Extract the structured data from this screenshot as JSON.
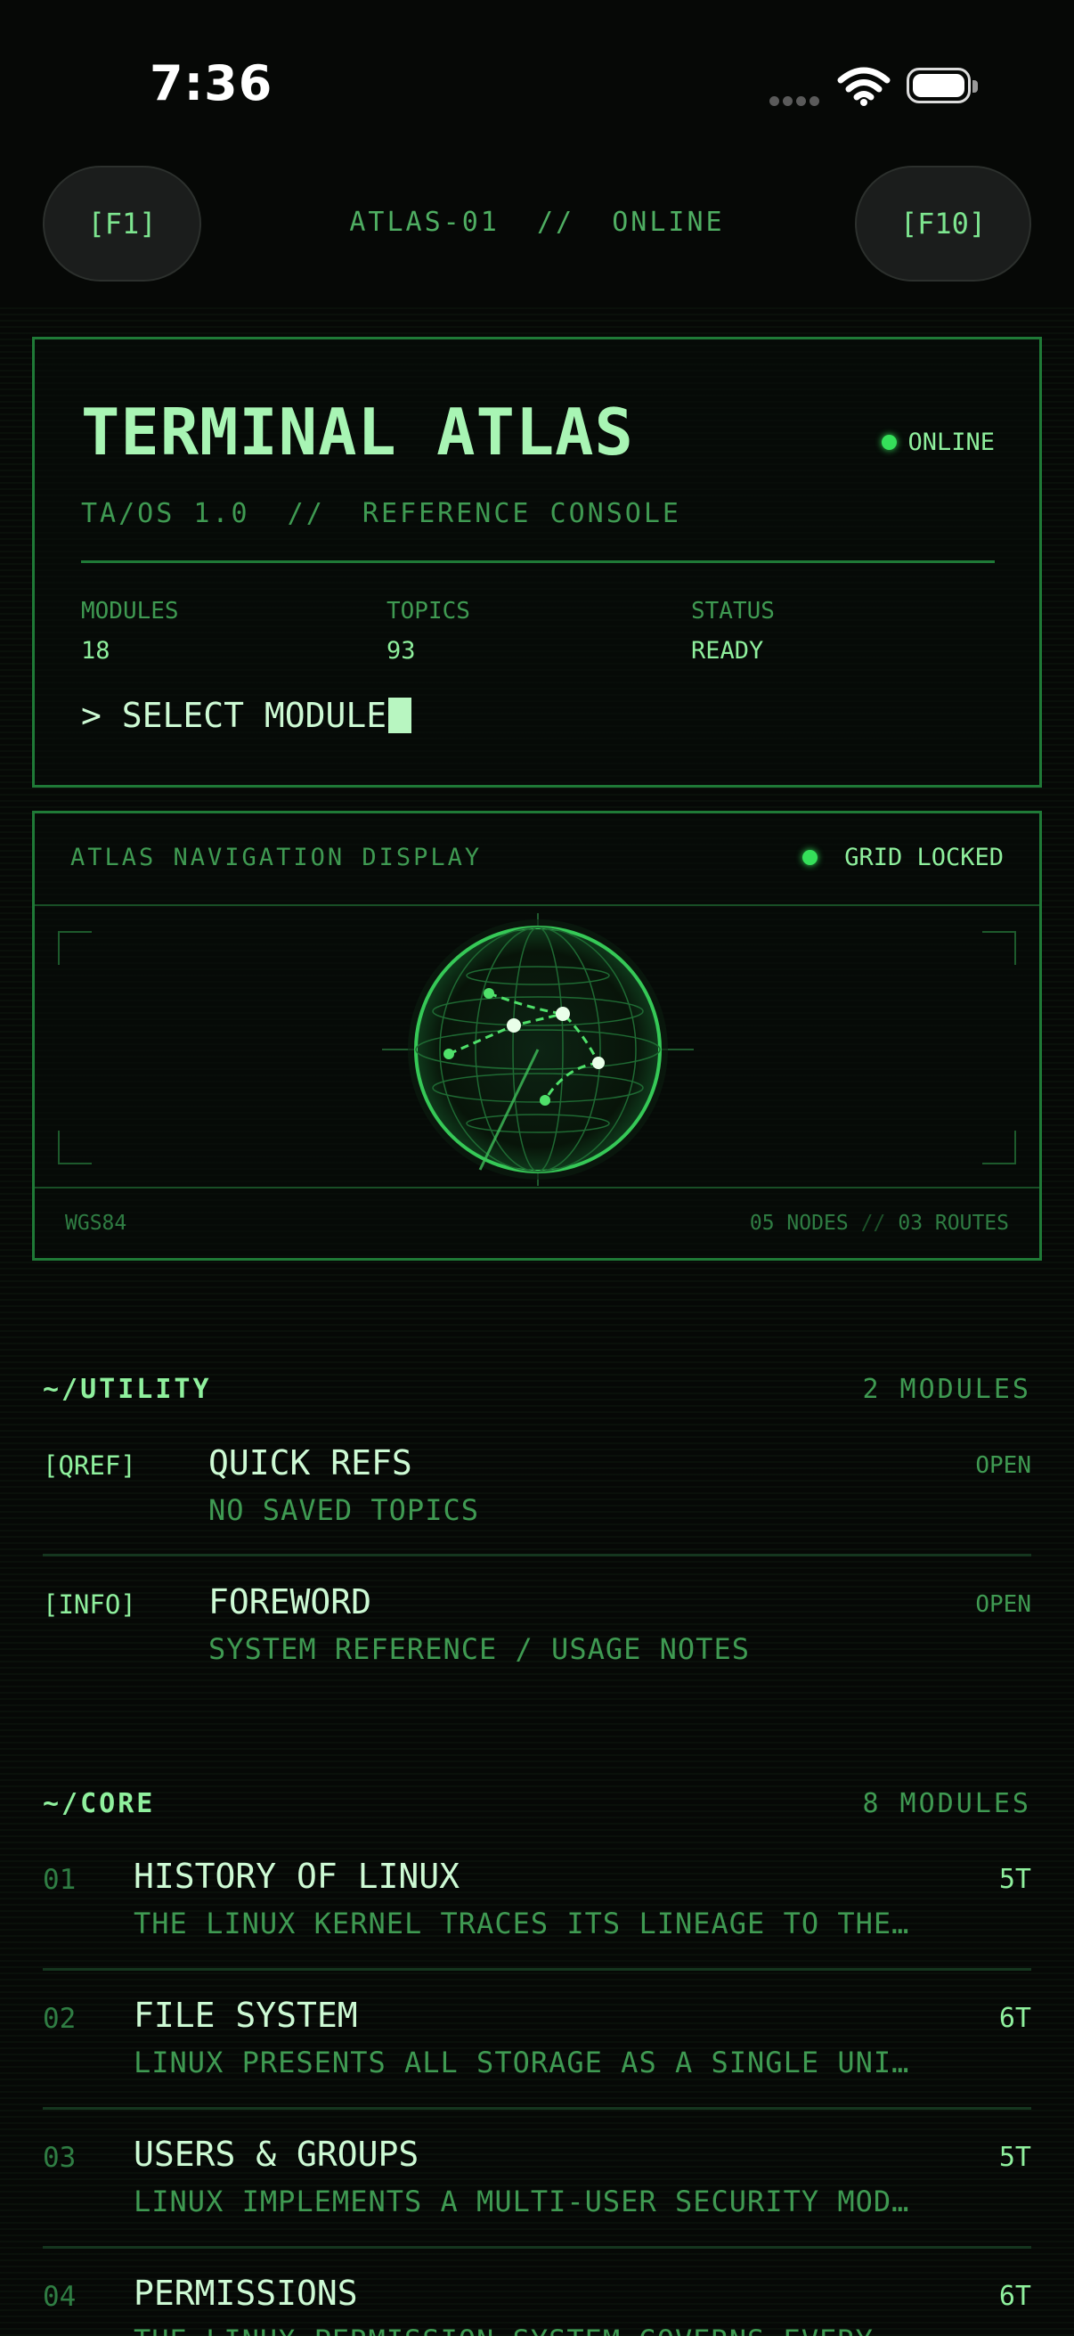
{
  "status_bar": {
    "time": "7:36"
  },
  "nav": {
    "left_key": "[F1]",
    "title": "ATLAS-01  //  ONLINE",
    "right_key": "[F10]"
  },
  "hero": {
    "title": "TERMINAL ATLAS",
    "status": "ONLINE",
    "subtitle": "TA/OS 1.0  //  REFERENCE CONSOLE",
    "stats": [
      {
        "label": "MODULES",
        "value": "18"
      },
      {
        "label": "TOPICS",
        "value": "93"
      },
      {
        "label": "STATUS",
        "value": "READY"
      }
    ],
    "prompt": "> SELECT MODULE"
  },
  "nav_display": {
    "title": "ATLAS NAVIGATION DISPLAY",
    "status": "GRID LOCKED",
    "datum": "WGS84",
    "nodes": "05 NODES",
    "separator": "//",
    "routes": "03 ROUTES"
  },
  "utility": {
    "name": "~/UTILITY",
    "count": "2 MODULES",
    "items": [
      {
        "tag": "[QREF]",
        "title": "QUICK REFS",
        "desc": "NO SAVED TOPICS",
        "action": "OPEN"
      },
      {
        "tag": "[INFO]",
        "title": "FOREWORD",
        "desc": "SYSTEM REFERENCE / USAGE NOTES",
        "action": "OPEN"
      }
    ]
  },
  "core": {
    "name": "~/CORE",
    "count": "8 MODULES",
    "items": [
      {
        "num": "01",
        "title": "HISTORY OF LINUX",
        "desc": "THE LINUX KERNEL TRACES ITS LINEAGE TO THE…",
        "count": "5T"
      },
      {
        "num": "02",
        "title": "FILE SYSTEM",
        "desc": "LINUX PRESENTS ALL STORAGE AS A SINGLE UNI…",
        "count": "6T"
      },
      {
        "num": "03",
        "title": "USERS & GROUPS",
        "desc": "LINUX IMPLEMENTS A MULTI-USER SECURITY MOD…",
        "count": "5T"
      },
      {
        "num": "04",
        "title": "PERMISSIONS",
        "desc": "THE LINUX PERMISSION SYSTEM GOVERNS EVERY…",
        "count": "6T"
      }
    ]
  },
  "colors": {
    "accent": "#35e05a",
    "text": "#8ff09d",
    "dim": "#3f9a52",
    "background": "#060806"
  }
}
